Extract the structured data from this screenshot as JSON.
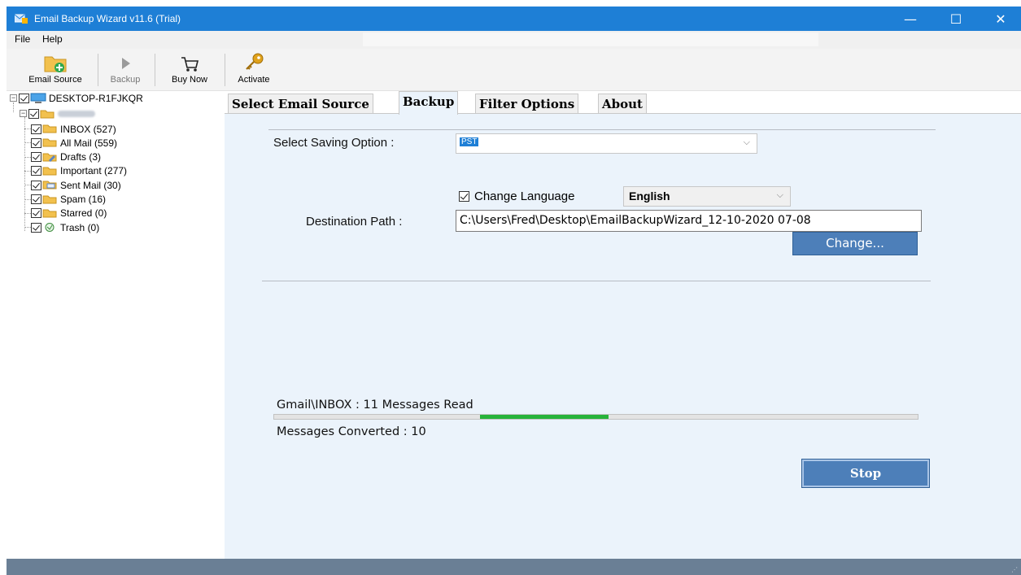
{
  "window": {
    "title": "Email Backup Wizard v11.6 (Trial)",
    "minimize": "—",
    "maximize": "☐",
    "close": "✕"
  },
  "menu": [
    "File",
    "Help"
  ],
  "toolbar": {
    "email_source": "Email Source",
    "backup": "Backup",
    "buy_now": "Buy Now",
    "activate": "Activate"
  },
  "tree": {
    "root": "DESKTOP-R1FJKQR",
    "folders": [
      {
        "label": "INBOX (527)",
        "icon": "folder-icon"
      },
      {
        "label": "All Mail (559)",
        "icon": "folder-icon"
      },
      {
        "label": "Drafts (3)",
        "icon": "drafts-folder-icon"
      },
      {
        "label": "Important (277)",
        "icon": "folder-icon"
      },
      {
        "label": "Sent Mail (30)",
        "icon": "sent-folder-icon"
      },
      {
        "label": "Spam (16)",
        "icon": "folder-icon"
      },
      {
        "label": "Starred (0)",
        "icon": "folder-icon"
      },
      {
        "label": "Trash (0)",
        "icon": "trash-icon"
      }
    ]
  },
  "tabs": [
    "Select Email Source",
    "Backup",
    "Filter Options",
    "About"
  ],
  "active_tab": "Backup",
  "backup": {
    "saving_option_label": "Select Saving Option :",
    "saving_option_value": "PST",
    "change_language_label": "Change Language",
    "language": "English",
    "destination_label": "Destination Path :",
    "destination_value": "C:\\Users\\Fred\\Desktop\\EmailBackupWizard_12-10-2020 07-08",
    "change_button": "Change...",
    "status_read": "Gmail\\INBOX : 11 Messages Read",
    "status_converted": "Messages Converted : 10",
    "stop_button": "Stop"
  },
  "progress": {
    "start_fraction": 0.32,
    "end_fraction": 0.52
  },
  "colors": {
    "titlebar": "#1e7fd6",
    "panel": "#ebf3fb",
    "button": "#4d7fb9",
    "progress": "#27b33a"
  }
}
